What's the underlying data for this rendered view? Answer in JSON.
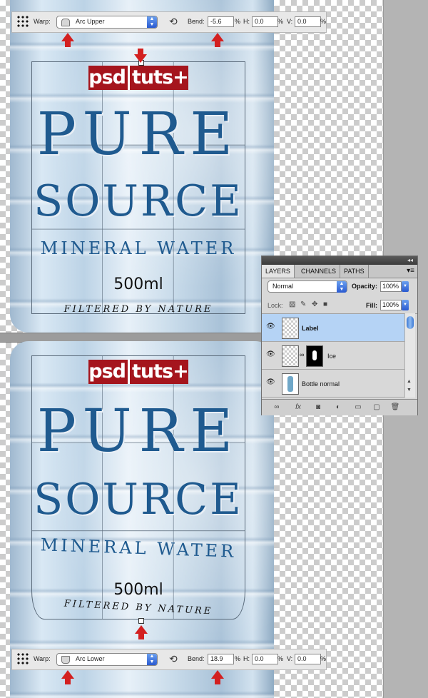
{
  "option_bar_top": {
    "warp_label": "Warp:",
    "warp_style": "Arc Upper",
    "bend_label": "Bend:",
    "bend_value": "-5.6",
    "bend_unit": "%",
    "h_label": "H:",
    "h_value": "0.0",
    "h_unit": "%",
    "v_label": "V:",
    "v_value": "0.0",
    "v_unit": "%"
  },
  "option_bar_bottom": {
    "warp_label": "Warp:",
    "warp_style": "Arc Lower",
    "bend_label": "Bend:",
    "bend_value": "18.9",
    "bend_unit": "%",
    "h_label": "H:",
    "h_value": "0.0",
    "h_unit": "%",
    "v_label": "V:",
    "v_value": "0.0",
    "v_unit": "%"
  },
  "label_artwork": {
    "brand_left": "psd",
    "brand_right": "tuts+",
    "line1": "PURE",
    "line2": "SOURCE",
    "line3": "MINERAL WATER",
    "volume": "500ml",
    "tagline": "FILTERED BY NATURE"
  },
  "layers_panel": {
    "tabs": [
      "LAYERS",
      "CHANNELS",
      "PATHS"
    ],
    "active_tab": "LAYERS",
    "blend_mode": "Normal",
    "opacity_label": "Opacity:",
    "opacity_value": "100%",
    "lock_label": "Lock:",
    "fill_label": "Fill:",
    "fill_value": "100%",
    "layers": [
      {
        "name": "Label",
        "selected": true
      },
      {
        "name": "Ice",
        "selected": false
      },
      {
        "name": "Bottle normal",
        "selected": false
      }
    ]
  },
  "colors": {
    "label_blue": "#1f5a8f",
    "brand_red": "#a5151d",
    "annotation_arrow": "#d32020",
    "selected_layer": "#b5d3f5"
  },
  "icons": {
    "reference_point": "reference-point-icon",
    "orientation": "change-orientation-icon",
    "eye": "eye-icon",
    "link": "link-icon",
    "panel_buttons": [
      "link-layers-icon",
      "fx-icon",
      "mask-icon",
      "adjustment-icon",
      "group-icon",
      "new-layer-icon",
      "trash-icon"
    ]
  }
}
